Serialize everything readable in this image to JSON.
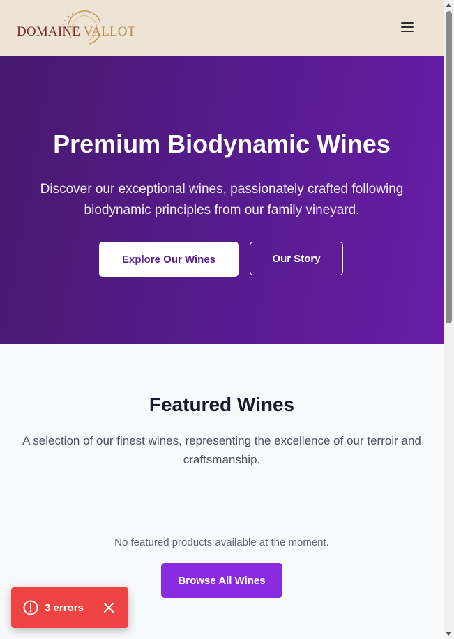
{
  "header": {
    "logo_word1": "DOMAINE",
    "logo_word2": "VALLOT",
    "menu_icon": "hamburger-menu-icon"
  },
  "hero": {
    "title": "Premium Biodynamic Wines",
    "subtitle": "Discover our exceptional wines, passionately crafted following biodynamic principles from our family vineyard.",
    "primary_button": "Explore Our Wines",
    "secondary_button": "Our Story"
  },
  "featured": {
    "title": "Featured Wines",
    "description": "A selection of our finest wines, representing the excellence of our terroir and craftsmanship.",
    "empty_message": "No featured products available at the moment.",
    "browse_button": "Browse All Wines"
  },
  "toast": {
    "label": "3 errors",
    "icon": "alert-circle-icon",
    "close_icon": "close-icon"
  },
  "colors": {
    "header_bg": "#ede4d6",
    "hero_start": "#461a6e",
    "hero_end": "#661ea6",
    "accent": "#8a2be2",
    "logo_dark": "#7c2f2a",
    "logo_gold": "#b88a4d",
    "toast_bg": "#ef4444"
  }
}
